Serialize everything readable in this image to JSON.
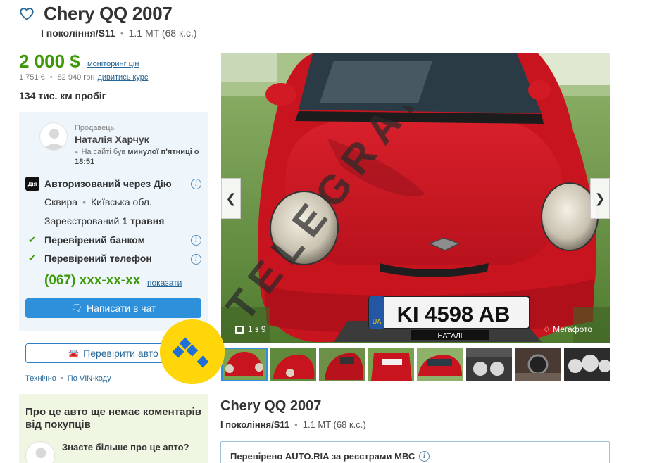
{
  "header": {
    "title": "Chery QQ 2007",
    "generation": "I покоління/S11",
    "engine": "1.1 MT (68 к.с.)"
  },
  "price": {
    "main": "2 000 $",
    "monitoring_link": "моніторинг цін",
    "eur": "1 751 €",
    "uah": "82 940 грн",
    "rate_link": "дивитись курс"
  },
  "mileage": "134 тис. км пробіг",
  "seller": {
    "role": "Продавець",
    "name": "Наталія Харчук",
    "seen_prefix": "На сайті був",
    "seen_when": "минулої п'ятниці о 18:51",
    "diia_icon_text": "Дія",
    "diia": "Авторизований через Дію",
    "city": "Сквира",
    "region": "Київська обл.",
    "registered_prefix": "Зареєстрований",
    "registered_date": "1 травня",
    "bank_verified": "Перевірений банком",
    "phone_verified": "Перевірений телефон",
    "phone": "(067) ххх-хх-хх",
    "phone_show": "показати",
    "chat_button": "Написати в чат"
  },
  "check": {
    "button": "Перевірити авто",
    "technical": "Технічно",
    "vin": "По VIN-коду"
  },
  "comment": {
    "title": "Про це авто ще немає коментарів від покупців",
    "question": "Знаєте більше про це авто?"
  },
  "photo": {
    "counter": "1 з 9",
    "megaphoto": "Мегафото",
    "plate": "KI 4598 AB",
    "plate_country": "UA",
    "plate_frame": "НАТАЛІ",
    "watermark": "TELEGRAF"
  },
  "listing": {
    "title": "Chery QQ 2007",
    "generation": "I покоління/S11",
    "engine": "1.1 MT (68 к.с.)",
    "verified": "Перевірено AUTO.RIA за реєстрами МВС"
  },
  "colors": {
    "price_green": "#3c9806",
    "link_blue": "#256799",
    "button_blue": "#2e8fdb",
    "card_bg": "#eef6fb",
    "badge_yellow": "#ffd60a"
  }
}
